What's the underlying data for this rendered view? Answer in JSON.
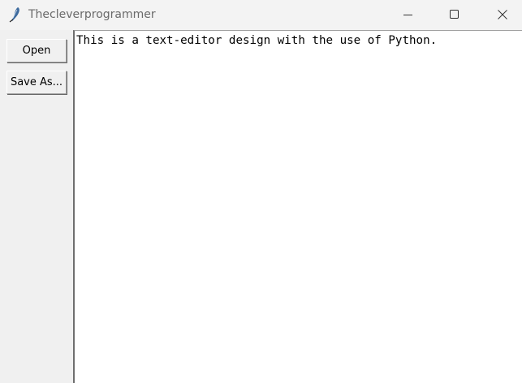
{
  "window": {
    "title": "Thecleverprogrammer",
    "icon": "feather-icon",
    "controls": [
      "minimize-icon",
      "maximize-icon",
      "close-icon"
    ]
  },
  "sidebar": {
    "open_label": "Open",
    "save_as_label": "Save As..."
  },
  "editor": {
    "text": "This is a text-editor design with the use of Python."
  }
}
